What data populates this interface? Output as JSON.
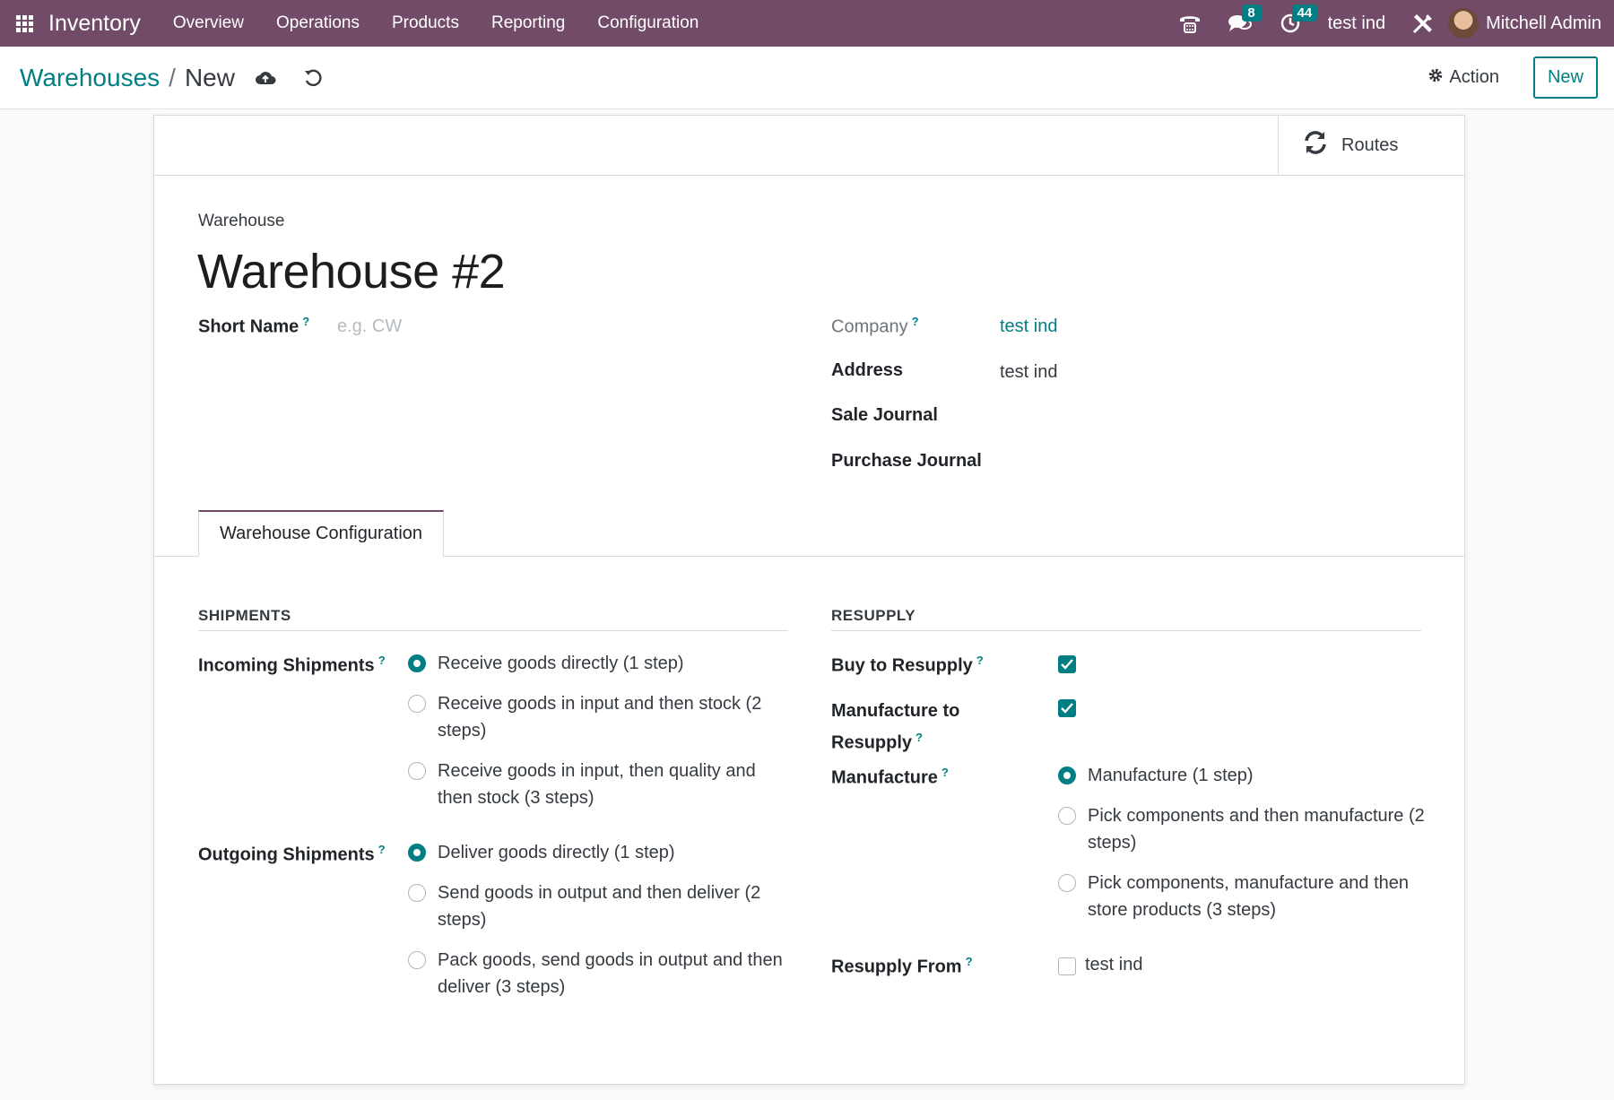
{
  "navbar": {
    "app_name": "Inventory",
    "menu": [
      "Overview",
      "Operations",
      "Products",
      "Reporting",
      "Configuration"
    ],
    "messages_count": "8",
    "activities_count": "44",
    "company": "test ind",
    "user_name": "Mitchell Admin"
  },
  "control_panel": {
    "breadcrumb_parent": "Warehouses",
    "breadcrumb_separator": "/",
    "breadcrumb_current": "New",
    "action_label": "Action",
    "new_label": "New"
  },
  "button_box": {
    "routes_label": "Routes"
  },
  "form": {
    "title_label": "Warehouse",
    "title": "Warehouse #2",
    "short_name_label": "Short Name",
    "short_name_placeholder": "e.g. CW",
    "company_label": "Company",
    "company_value": "test ind",
    "address_label": "Address",
    "address_value": "test ind",
    "sale_journal_label": "Sale Journal",
    "purchase_journal_label": "Purchase Journal",
    "help_mark": "?"
  },
  "tabs": [
    {
      "label": "Warehouse Configuration",
      "active": true
    }
  ],
  "shipments": {
    "title": "SHIPMENTS",
    "incoming_label": "Incoming Shipments",
    "incoming_options": [
      {
        "label": "Receive goods directly (1 step)",
        "selected": true
      },
      {
        "label": "Receive goods in input and then stock (2 steps)",
        "selected": false
      },
      {
        "label": "Receive goods in input, then quality and then stock (3 steps)",
        "selected": false
      }
    ],
    "outgoing_label": "Outgoing Shipments",
    "outgoing_options": [
      {
        "label": "Deliver goods directly (1 step)",
        "selected": true
      },
      {
        "label": "Send goods in output and then deliver (2 steps)",
        "selected": false
      },
      {
        "label": "Pack goods, send goods in output and then deliver (3 steps)",
        "selected": false
      }
    ]
  },
  "resupply": {
    "title": "RESUPPLY",
    "buy_label": "Buy to Resupply",
    "buy_checked": true,
    "manufacture_to_label": "Manufacture to Resupply",
    "manufacture_to_checked": true,
    "manufacture_label": "Manufacture",
    "manufacture_options": [
      {
        "label": "Manufacture (1 step)",
        "selected": true
      },
      {
        "label": "Pick components and then manufacture (2 steps)",
        "selected": false
      },
      {
        "label": "Pick components, manufacture and then store products (3 steps)",
        "selected": false
      }
    ],
    "resupply_from_label": "Resupply From",
    "resupply_from_option": "test ind",
    "resupply_from_checked": false
  },
  "colors": {
    "brand": "#714b67",
    "accent": "#017e84"
  }
}
